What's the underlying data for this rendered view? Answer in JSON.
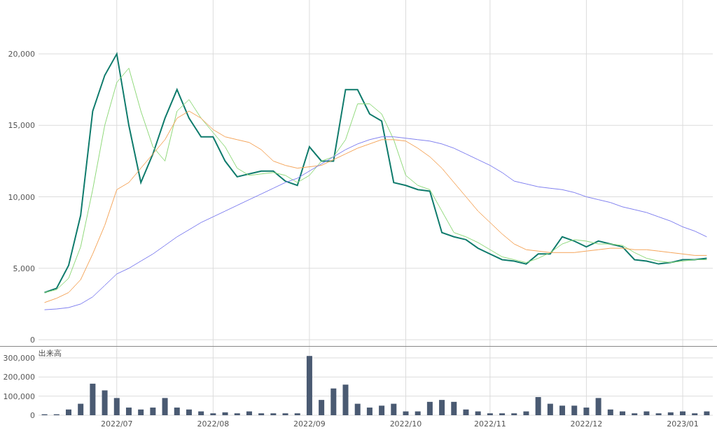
{
  "price_chart": {
    "chart_data": {
      "type": "line",
      "series": [
        {
          "color": "#0f7b6c",
          "values": [
            3300,
            3600,
            5200,
            8700,
            16000,
            18500,
            20000,
            15000,
            11000,
            13000,
            15500,
            17500,
            15500,
            14200,
            14200,
            12500,
            11400,
            11600,
            11800,
            11800,
            11100,
            10800,
            13500,
            12500,
            12500,
            17500,
            17500,
            15800,
            15300,
            11000,
            10800,
            10500,
            10400,
            7500,
            7200,
            7000,
            6400,
            6000,
            5600,
            5500,
            5300,
            6000,
            6000,
            7200,
            6900,
            6500,
            6900,
            6700,
            6500,
            5600,
            5500,
            5300,
            5400,
            5600,
            5600,
            5700
          ]
        },
        {
          "color": "#8fd97a",
          "values": [
            3300,
            3500,
            4300,
            6500,
            10500,
            15000,
            18000,
            19000,
            16000,
            13500,
            12500,
            16000,
            16800,
            15500,
            14500,
            13500,
            12000,
            11500,
            11600,
            11700,
            11500,
            11000,
            11500,
            12500,
            12800,
            14000,
            16500,
            16500,
            15800,
            14000,
            11500,
            10800,
            10500,
            9000,
            7500,
            7200,
            6800,
            6300,
            5800,
            5600,
            5400,
            5700,
            6100,
            6700,
            7000,
            6900,
            6700,
            6700,
            6600,
            6100,
            5700,
            5500,
            5400,
            5500,
            5600,
            5600
          ]
        },
        {
          "color": "#f5a55a",
          "values": [
            2600,
            2900,
            3300,
            4200,
            6000,
            8000,
            10500,
            11000,
            12000,
            13000,
            14000,
            15500,
            16000,
            15500,
            14700,
            14200,
            14000,
            13800,
            13300,
            12500,
            12200,
            12000,
            12100,
            12200,
            12600,
            13000,
            13400,
            13700,
            14000,
            14000,
            13900,
            13400,
            12800,
            12000,
            11000,
            10000,
            9000,
            8200,
            7400,
            6700,
            6300,
            6200,
            6100,
            6100,
            6100,
            6200,
            6300,
            6400,
            6400,
            6300,
            6300,
            6200,
            6100,
            6000,
            5900,
            5900
          ]
        },
        {
          "color": "#8080f0",
          "values": [
            2100,
            2150,
            2250,
            2500,
            3000,
            3800,
            4600,
            5000,
            5500,
            6000,
            6600,
            7200,
            7700,
            8200,
            8600,
            9000,
            9400,
            9800,
            10200,
            10600,
            11000,
            11300,
            11800,
            12300,
            12800,
            13300,
            13700,
            14000,
            14200,
            14200,
            14100,
            14000,
            13900,
            13700,
            13400,
            13000,
            12600,
            12200,
            11700,
            11100,
            10900,
            10700,
            10600,
            10500,
            10300,
            10000,
            9800,
            9600,
            9300,
            9100,
            8900,
            8600,
            8300,
            7900,
            7600,
            7200
          ]
        }
      ],
      "ylim": [
        0,
        23770
      ],
      "grid": true,
      "yticks": [
        {
          "value": 0,
          "label": "0"
        },
        {
          "value": 5000,
          "label": "5,000"
        },
        {
          "value": 10000,
          "label": "10,000"
        },
        {
          "value": 15000,
          "label": "15,000"
        },
        {
          "value": 20000,
          "label": "20,000"
        }
      ]
    }
  },
  "volume_chart": {
    "chart_data": {
      "type": "bar",
      "title": "出来高",
      "categories": [
        null,
        null,
        null,
        null,
        null,
        null,
        "2022/07",
        null,
        null,
        null,
        null,
        null,
        null,
        null,
        "2022/08",
        null,
        null,
        null,
        null,
        null,
        null,
        null,
        "2022/09",
        null,
        null,
        null,
        null,
        null,
        null,
        null,
        "2022/10",
        null,
        null,
        null,
        null,
        null,
        null,
        "2022/11",
        null,
        null,
        null,
        null,
        null,
        null,
        null,
        "2022/12",
        null,
        null,
        null,
        null,
        null,
        null,
        null,
        "2023/01",
        null,
        null
      ],
      "values": [
        5000,
        5000,
        30000,
        60000,
        165000,
        130000,
        90000,
        40000,
        30000,
        40000,
        90000,
        40000,
        30000,
        20000,
        10000,
        15000,
        10000,
        20000,
        10000,
        10000,
        10000,
        10000,
        310000,
        80000,
        140000,
        160000,
        60000,
        40000,
        50000,
        60000,
        20000,
        20000,
        70000,
        80000,
        70000,
        30000,
        20000,
        10000,
        10000,
        10000,
        20000,
        95000,
        60000,
        50000,
        50000,
        40000,
        90000,
        30000,
        20000,
        10000,
        20000,
        10000,
        15000,
        20000,
        10000,
        20000
      ],
      "ylim": [
        0,
        362000
      ],
      "grid": true,
      "yticks": [
        {
          "value": 0,
          "label": "0"
        },
        {
          "value": 100000,
          "label": "100,000"
        },
        {
          "value": 200000,
          "label": "200,000"
        },
        {
          "value": 300000,
          "label": "300,000"
        }
      ]
    }
  }
}
